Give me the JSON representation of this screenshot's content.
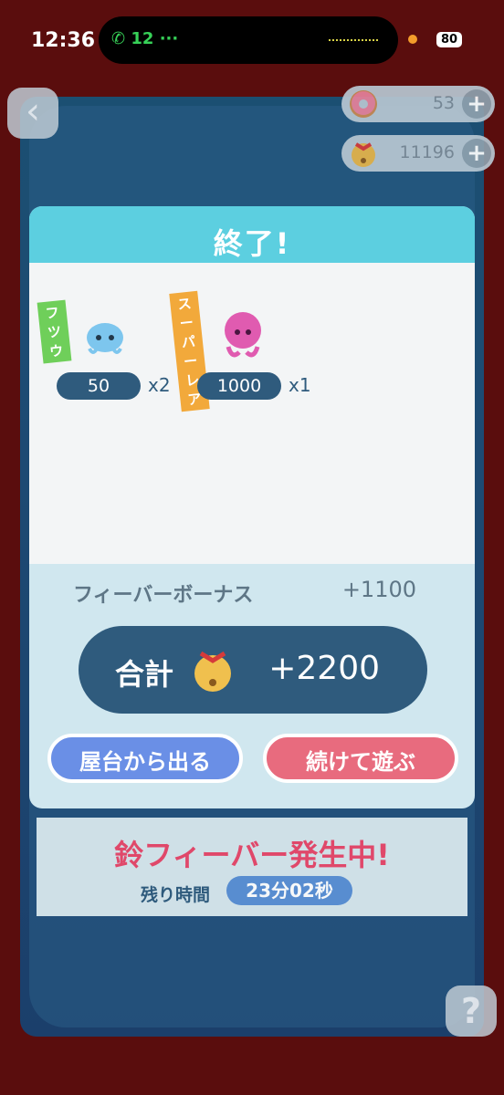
{
  "status_bar": {
    "time": "12:36",
    "call": "12",
    "battery": "80"
  },
  "currencies": {
    "donut": "53",
    "bell": "11196"
  },
  "panel": {
    "title": "終了!",
    "items": [
      {
        "rarity": "フツウ",
        "score": "50",
        "multiplier": "x2",
        "tag_color": "#6fcf5a"
      },
      {
        "rarity": "スーパーレア",
        "score": "1000",
        "multiplier": "x1",
        "tag_color": "#f2a93b"
      }
    ],
    "bonus_label": "フィーバーボーナス",
    "bonus_value": "+1100",
    "total_label": "合計",
    "total_value": "+2200",
    "leave_label": "屋台から出る",
    "continue_label": "続けて遊ぶ"
  },
  "fever": {
    "title": "鈴フィーバー発生中!",
    "label": "残り時間",
    "time": "23分02秒"
  },
  "help_label": "?",
  "colors": {
    "accent_blue": "#2f5b7d",
    "header_cyan": "#5ccfe0",
    "fever_pink": "#e8486a"
  }
}
